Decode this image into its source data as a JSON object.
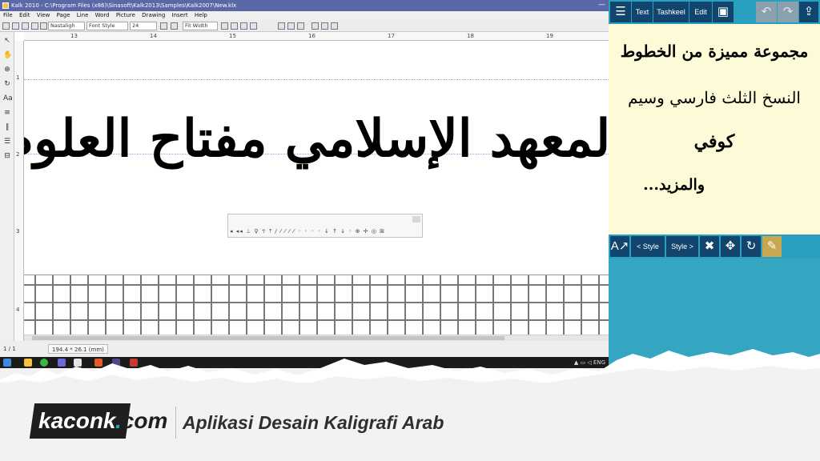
{
  "window": {
    "title": "Kalk 2010 - C:\\Program Files (x86)\\Sinasoft\\Kalk2013\\Samples\\Kalk2007\\New.klx",
    "minimize": "—"
  },
  "menu": [
    "File",
    "Edit",
    "View",
    "Page",
    "Line",
    "Word",
    "Picture",
    "Drawing",
    "Insert",
    "Help"
  ],
  "toolbar": {
    "font_script": "Nastaligh",
    "font_style": "Font Style",
    "font_size": "24",
    "zoom": "Fit Width"
  },
  "ruler": {
    "h": [
      "13",
      "14",
      "15",
      "16",
      "17",
      "18",
      "19"
    ],
    "v": [
      "1",
      "2",
      "3",
      "4"
    ]
  },
  "left_tools": [
    "↖",
    "✋",
    "⊕",
    "↻",
    "Aa",
    "≡",
    "∥",
    "☰",
    "⊟"
  ],
  "canvas": {
    "calligraphy": "المعهد الإسلامي مفتاح العلوم بانيبيين"
  },
  "floatbar": {
    "tools": "◂ ◂◂ ⊥ ♀ ☥ ⤒ / ⁄ ⁄ ⁄ ⁄ ◦ ◦ ◦ ◦ ↓ ↑ ↓ ◦ ⊕ ✢ ◎ ⊞"
  },
  "status": {
    "page": "1 / 1",
    "coords": "194.4 * 26.1 (mm)"
  },
  "taskbar": {
    "tray": "▲ ▭ ◁ ENG"
  },
  "app": {
    "top_buttons": {
      "text": "Text",
      "tashkeel": "Tashkeel",
      "edit": "Edit"
    },
    "notes": [
      "مجموعة مميزة من الخطوط",
      "النسخ الثلث فارسي وسيم",
      "كوفي",
      "والمزيد..."
    ],
    "style_buttons": {
      "prev": "< Style",
      "next": "Style >"
    }
  },
  "banner": {
    "logo_word": "kaconk",
    "logo_dot": ".",
    "logo_tld": "com",
    "tagline": "Aplikasi Desain Kaligrafi Arab"
  },
  "colors": {
    "app_teal": "#34a6c2",
    "app_button_navy": "#12456d",
    "notes_cream": "#fdfbd7",
    "title_bar": "#5a68a8",
    "logo_accent": "#1fa8c9"
  }
}
